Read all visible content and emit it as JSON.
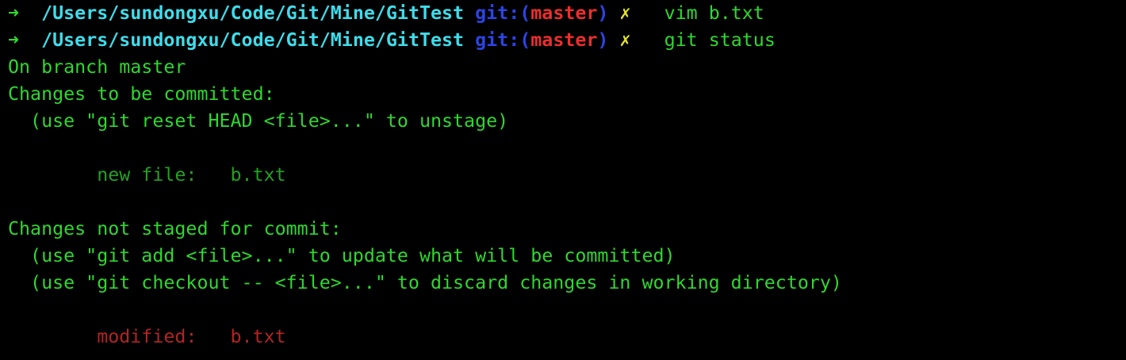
{
  "colors": {
    "background": "#000000",
    "prompt_arrow": "#2fd82f",
    "path": "#3fdcea",
    "git_label": "#2c44e6",
    "branch": "#ea2e2e",
    "dirty_mark": "#e3e22d",
    "output_text": "#2fd82f",
    "staged_entry": "#25a025",
    "modified_entry": "#b32424"
  },
  "prompts": [
    {
      "arrow": "➜",
      "path": "/Users/sundongxu/Code/Git/Mine/GitTest",
      "git_prefix": "git:(",
      "branch": "master",
      "git_suffix": ")",
      "dirty_mark": "✗",
      "command": "vim b.txt"
    },
    {
      "arrow": "➜",
      "path": "/Users/sundongxu/Code/Git/Mine/GitTest",
      "git_prefix": "git:(",
      "branch": "master",
      "git_suffix": ")",
      "dirty_mark": "✗",
      "command": "git status"
    }
  ],
  "output": {
    "on_branch": "On branch master",
    "staged_header": "Changes to be committed:",
    "staged_hint": "  (use \"git reset HEAD <file>...\" to unstage)",
    "staged_entry": "        new file:   b.txt",
    "unstaged_header": "Changes not staged for commit:",
    "unstaged_hint_1": "  (use \"git add <file>...\" to update what will be committed)",
    "unstaged_hint_2": "  (use \"git checkout -- <file>...\" to discard changes in working directory)",
    "modified_entry": "        modified:   b.txt"
  }
}
